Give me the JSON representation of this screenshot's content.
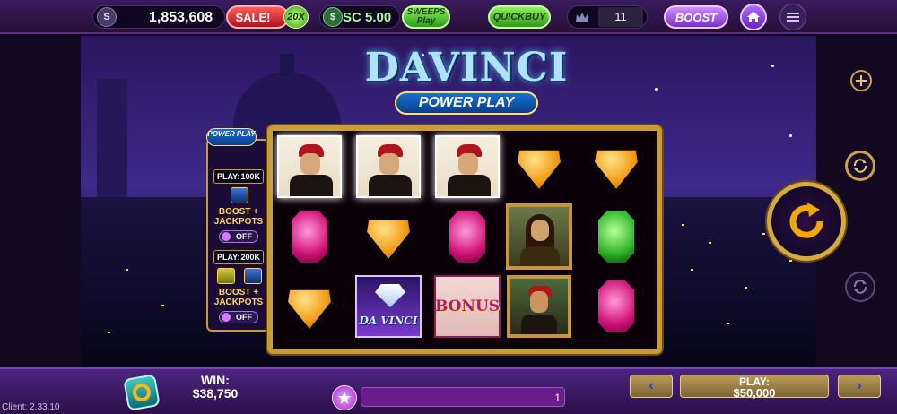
{
  "topbar": {
    "gold_coin_icon": "gold-coin-icon",
    "gold_coin_letter": "S",
    "gold_balance": "1,853,608",
    "sale_label": "SALE!",
    "sale_badge": "20X",
    "sweeps_coin_letter": "$",
    "sweeps_balance": "SC 5.00",
    "sweeps_play_label": "SWEEPS Play",
    "quick_buy_label": "QUICKBUY",
    "crown_icon": "crown-icon",
    "level": "11",
    "boost_label": "BOOST",
    "home_icon": "home-icon",
    "menu_icon": "menu-icon"
  },
  "game": {
    "title": "DAVINCI",
    "subtitle": "POWER PLAY"
  },
  "side_panel": {
    "header": "POWER PLAY",
    "tier1": {
      "play_label": "PLAY:",
      "play_value": "100K",
      "feature": "BOOST + JACKPOTS",
      "toggle": "OFF"
    },
    "tier2": {
      "play_label": "PLAY:",
      "play_value": "200K",
      "feature": "BOOST + JACKPOTS",
      "toggle": "OFF"
    }
  },
  "reels": [
    [
      "portrait-glow",
      "gem-pink",
      "gem-orange"
    ],
    [
      "portrait-glow",
      "gem-orange",
      "wild-davinci"
    ],
    [
      "portrait-glow",
      "gem-pink",
      "bonus"
    ],
    [
      "gem-orange",
      "mona-lisa",
      "framed-portrait"
    ],
    [
      "gem-orange",
      "gem-green",
      "gem-pink"
    ]
  ],
  "reel_text": {
    "wild_label": "DA VINCI",
    "bonus_label": "BONUS"
  },
  "right_controls": {
    "plus_icon": "plus-icon",
    "autospin_icon": "autospin-icon",
    "spin_icon": "spin-arrow-icon",
    "turbo_icon": "turbo-icon"
  },
  "bottombar": {
    "win_label": "WIN:",
    "win_value": "$38,750",
    "progress_value": "1",
    "star_icon": "star-icon",
    "play_label": "PLAY:",
    "play_value": "$50,000",
    "prev_arrow": "‹",
    "next_arrow": "›"
  },
  "client_version": "Client: 2.33.10"
}
